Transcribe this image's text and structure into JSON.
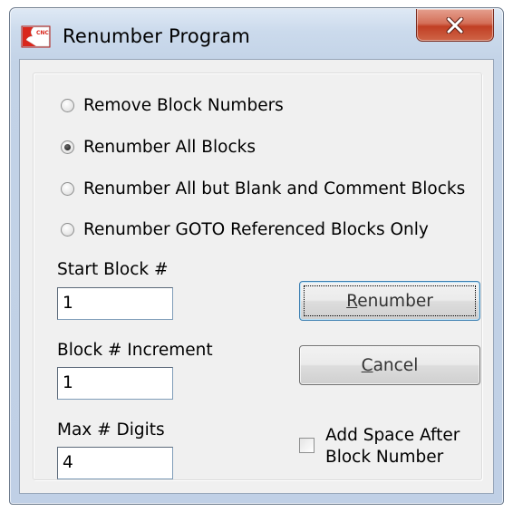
{
  "window": {
    "title": "Renumber Program",
    "icon": "cnc-app-icon",
    "close_icon": "close-icon",
    "colors": {
      "close_button": "#c84a2e",
      "title_bar": "#cbdaec",
      "client_area": "#f0f0f0"
    }
  },
  "options": {
    "items": [
      {
        "label": "Remove Block Numbers",
        "selected": false
      },
      {
        "label": "Renumber All Blocks",
        "selected": true
      },
      {
        "label": "Renumber All but Blank and Comment Blocks",
        "selected": false
      },
      {
        "label": "Renumber GOTO Referenced Blocks Only",
        "selected": false
      }
    ]
  },
  "fields": {
    "start": {
      "label": "Start Block #",
      "value": "1"
    },
    "increment": {
      "label": "Block # Increment",
      "value": "1"
    },
    "digits": {
      "label": "Max # Digits",
      "value": "4"
    }
  },
  "buttons": {
    "renumber": {
      "mnemonic": "R",
      "rest": "enumber"
    },
    "cancel": {
      "mnemonic": "C",
      "rest": "ancel"
    }
  },
  "add_space": {
    "line1": "Add Space After",
    "line2": "Block Number",
    "checked": false
  }
}
